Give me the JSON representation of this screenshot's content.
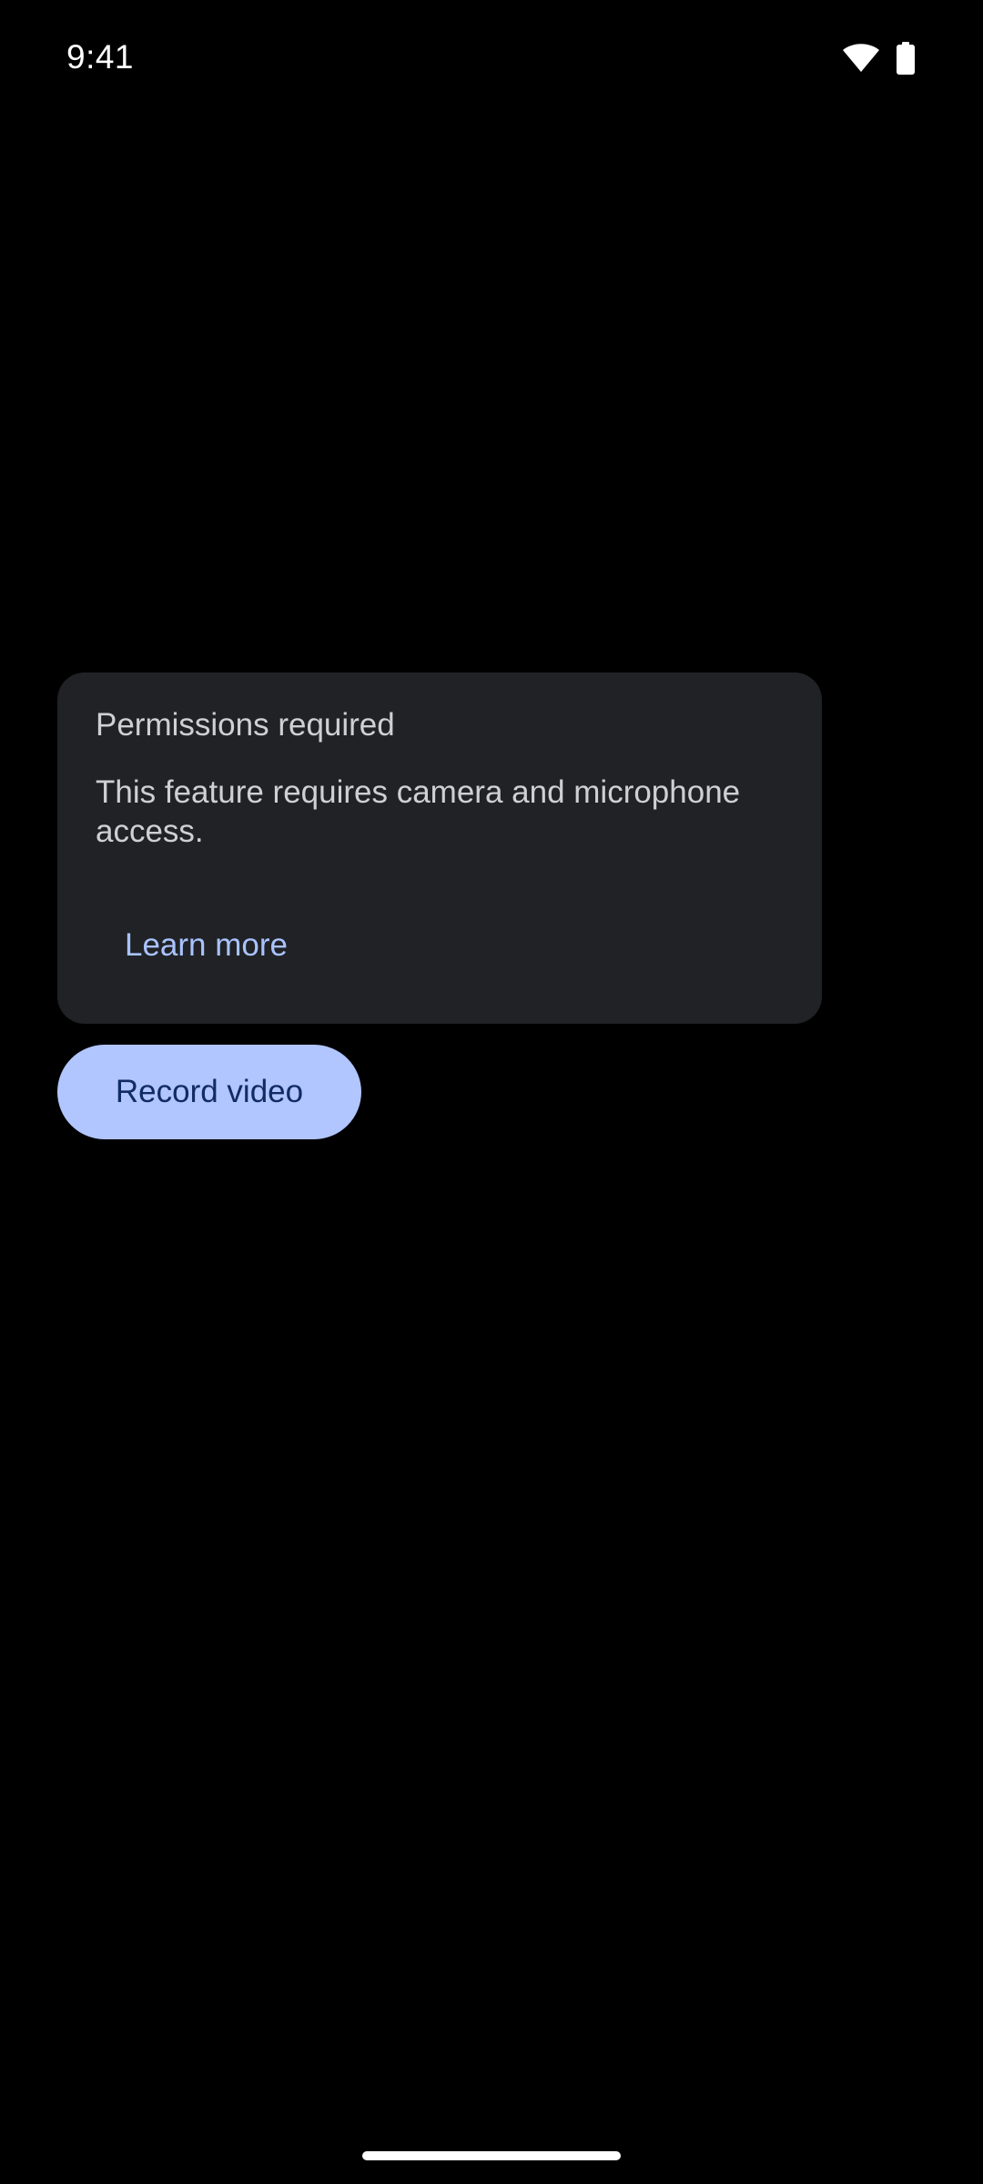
{
  "status_bar": {
    "time": "9:41",
    "icons": [
      "wifi-icon",
      "battery-icon"
    ]
  },
  "permission_card": {
    "title": "Permissions required",
    "message": "This feature requires camera and microphone access.",
    "link_label": "Learn more"
  },
  "record_button": {
    "label": "Record video"
  },
  "colors": {
    "background": "#000000",
    "card_background": "#212226",
    "card_text": "#cfd0d6",
    "link": "#a9c3ff",
    "button_background": "#b1c5ff",
    "button_text": "#112c62"
  }
}
